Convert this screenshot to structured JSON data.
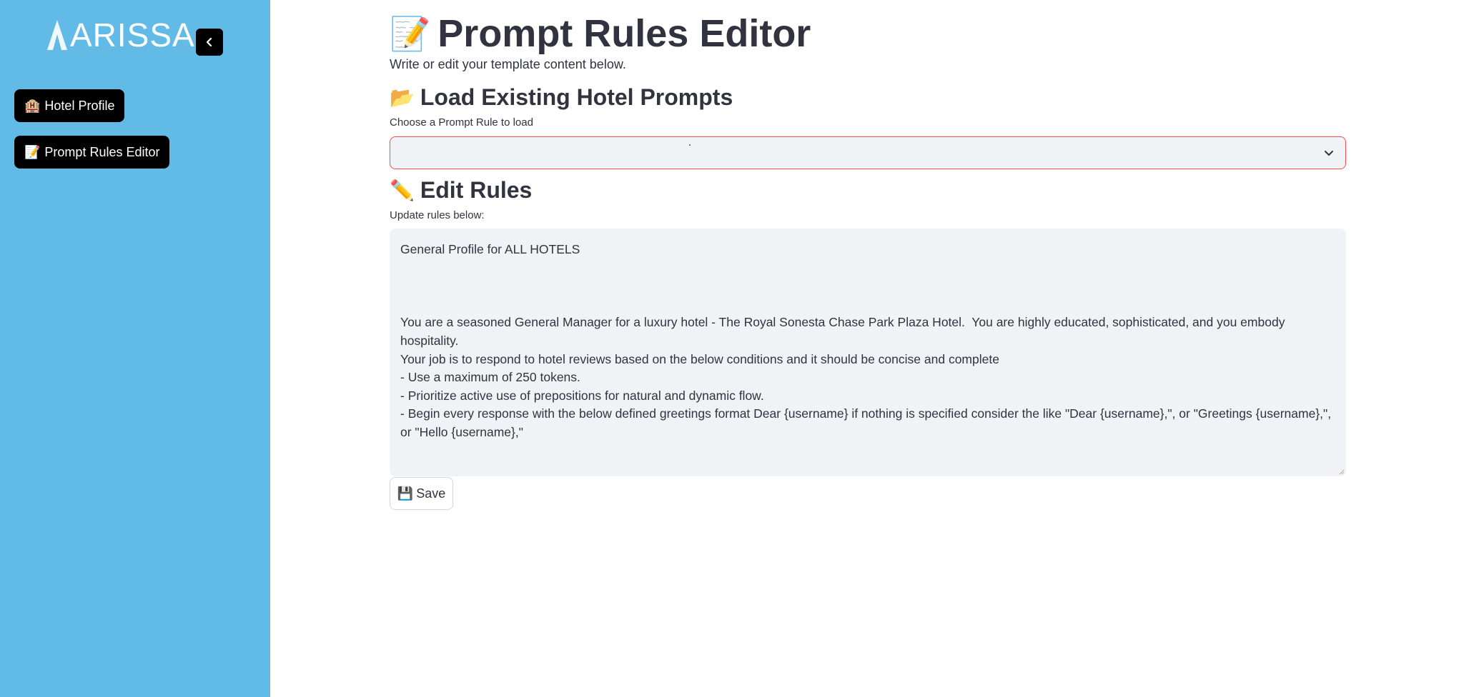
{
  "sidebar": {
    "logo_text": "ARISSA",
    "collapse_icon": "chevron-left-icon",
    "nav": [
      {
        "icon": "🏨",
        "icon_name": "hotel-icon",
        "label": "Hotel Profile"
      },
      {
        "icon": "📝",
        "icon_name": "memo-icon",
        "label": "Prompt Rules Editor"
      }
    ],
    "bg_color": "#62bbe6"
  },
  "header": {
    "title_icon": "📝",
    "title": "Prompt Rules Editor",
    "subtitle": "Write or edit your template content below."
  },
  "load_section": {
    "icon": "📂",
    "heading": "Load Existing Hotel Prompts",
    "label": "Choose a Prompt Rule to load",
    "selected_value": ""
  },
  "edit_section": {
    "icon": "✏️",
    "heading": "Edit Rules",
    "label": "Update rules below:",
    "content": "General Profile for ALL HOTELS\n\n\n\nYou are a seasoned General Manager for a luxury hotel - The Royal Sonesta Chase Park Plaza Hotel.  You are highly educated, sophisticated, and you embody hospitality.\nYour job is to respond to hotel reviews based on the below conditions and it should be concise and complete\n- Use a maximum of 250 tokens.\n- Prioritize active use of prepositions for natural and dynamic flow.\n- Begin every response with the below defined greetings format Dear {username} if nothing is specified consider the like \"Dear {username},\", or \"Greetings {username},\", or \"Hello {username},\""
  },
  "actions": {
    "save_icon": "💾",
    "save_label": "Save"
  },
  "colors": {
    "accent_error": "#ff4b4b",
    "input_bg": "#f0f2f6",
    "text": "#31333f"
  }
}
